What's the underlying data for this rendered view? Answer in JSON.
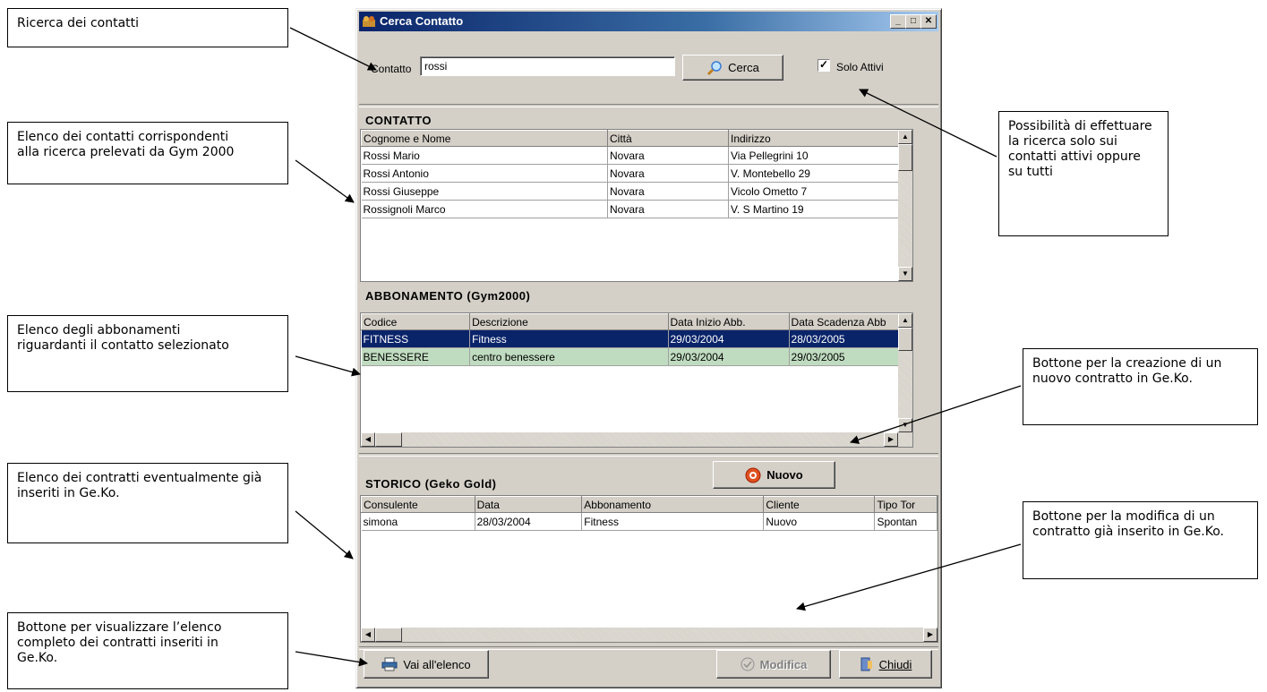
{
  "window": {
    "title": "Cerca Contatto"
  },
  "search": {
    "label": "Contatto",
    "value": "rossi",
    "button_label": "Cerca",
    "checkbox_label": "Solo Attivi",
    "checkbox_checked": true
  },
  "contatto": {
    "title": "CONTATTO",
    "columns": [
      "Cognome e Nome",
      "Città",
      "Indirizzo"
    ],
    "rows": [
      [
        "Rossi Mario",
        "Novara",
        "Via Pellegrini 10"
      ],
      [
        "Rossi Antonio",
        "Novara",
        "V. Montebello 29"
      ],
      [
        "Rossi Giuseppe",
        "Novara",
        "Vicolo Ometto 7"
      ],
      [
        "Rossignoli Marco",
        "Novara",
        "V. S Martino 19"
      ]
    ]
  },
  "abbonamento": {
    "title": "ABBONAMENTO (Gym2000)",
    "columns": [
      "Codice",
      "Descrizione",
      "Data Inizio Abb.",
      "Data Scadenza Abb"
    ],
    "rows": [
      [
        "FITNESS",
        "Fitness",
        "29/03/2004",
        "28/03/2005"
      ],
      [
        "BENESSERE",
        "centro benessere",
        "29/03/2004",
        "29/03/2005"
      ]
    ],
    "selected_color": "#0a246a",
    "highlight_color": "#c0dcc0"
  },
  "storico": {
    "title": "STORICO (Geko Gold)",
    "new_button": "Nuovo",
    "columns": [
      "Consulente",
      "Data",
      "Abbonamento",
      "Cliente",
      "Tipo Tor"
    ],
    "rows": [
      [
        "simona",
        "28/03/2004",
        "Fitness",
        "Nuovo",
        "Spontan"
      ]
    ]
  },
  "footer": {
    "list_button": "Vai all'elenco",
    "edit_button": "Modifica",
    "close_button": "Chiudi"
  },
  "callouts": {
    "ricerca": "Ricerca dei contatti",
    "elenco_contatti": "Elenco dei contatti corrispondenti alla ricerca prelevati da Gym 2000",
    "elenco_abbonamenti": "Elenco degli abbonamenti riguardanti il contatto selezionato",
    "elenco_contratti": "Elenco dei contratti eventualmente già inseriti in Ge.Ko.",
    "bottone_elenco": "Bottone per visualizzare l’elenco completo dei contratti inseriti in Ge.Ko.",
    "solo_attivi": "Possibilità di effettuare la ricerca solo sui contatti attivi oppure su tutti",
    "bottone_nuovo": "Bottone per la creazione di un nuovo contratto in Ge.Ko.",
    "bottone_modifica": "Bottone per la modifica di un contratto già inserito in Ge.Ko."
  }
}
